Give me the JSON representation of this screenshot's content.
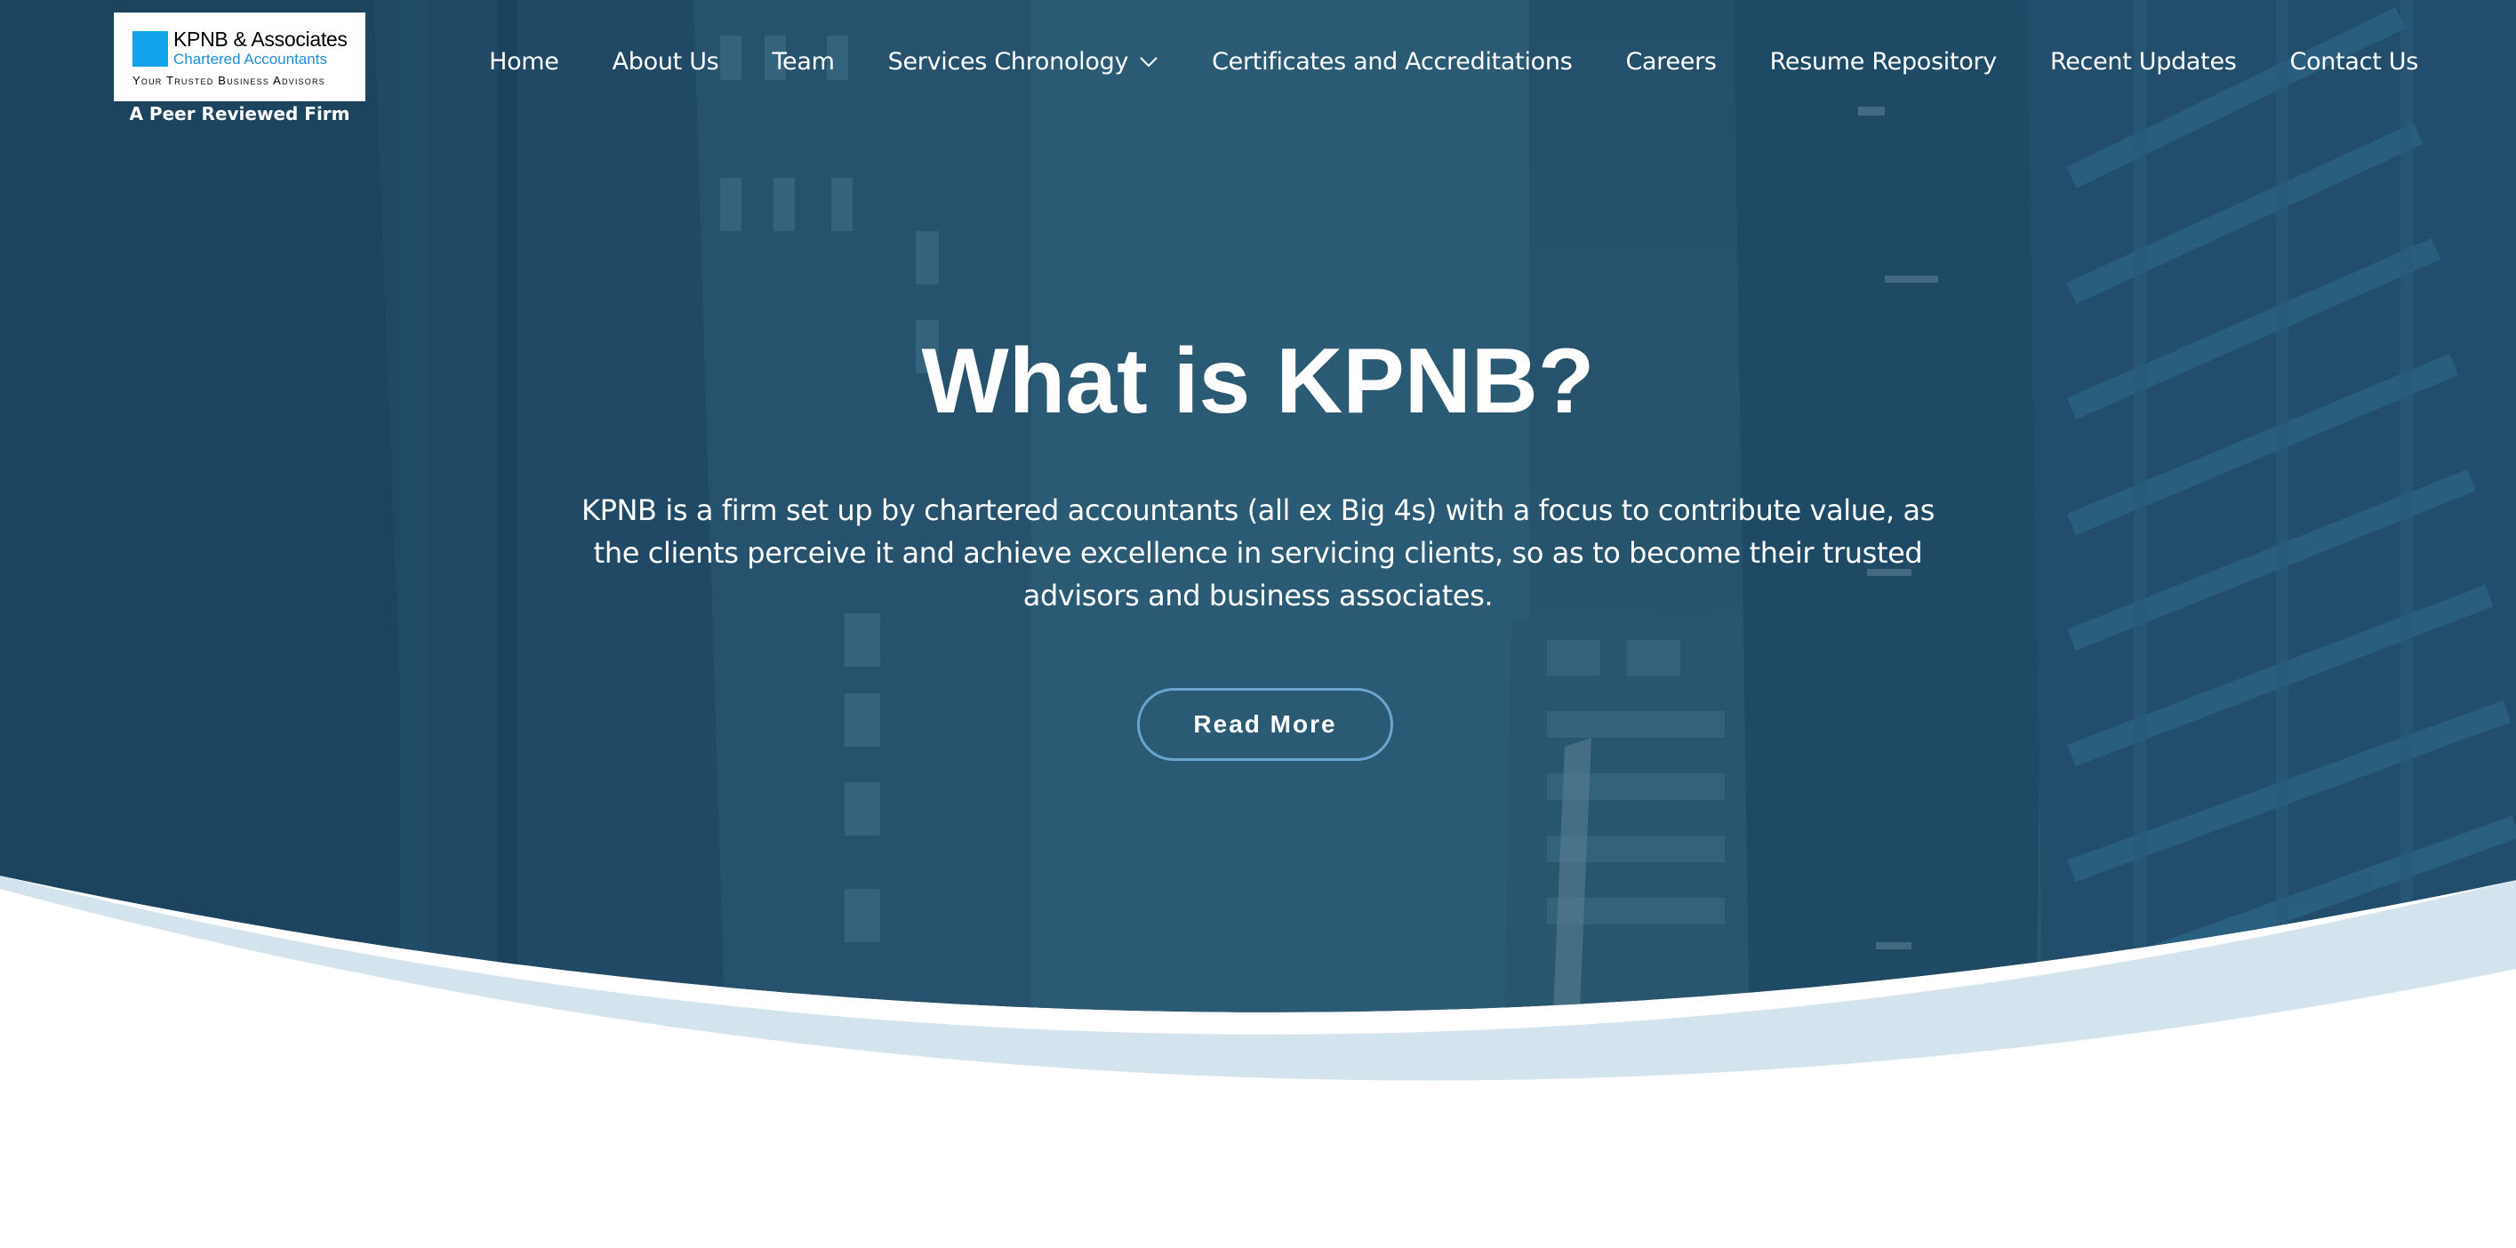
{
  "brand": {
    "name": "KPNB & Associates",
    "subtitle": "Chartered Accountants",
    "tagline": "Your Trusted Business Advisors",
    "peer_note": "A Peer Reviewed Firm"
  },
  "nav": {
    "items": [
      {
        "label": "Home"
      },
      {
        "label": "About Us"
      },
      {
        "label": "Team"
      },
      {
        "label": "Services Chronology",
        "has_dropdown": true
      },
      {
        "label": "Certificates and Accreditations"
      },
      {
        "label": "Careers"
      },
      {
        "label": "Resume Repository"
      },
      {
        "label": "Recent Updates"
      },
      {
        "label": "Contact Us"
      }
    ]
  },
  "hero": {
    "title": "What is KPNB?",
    "description": "KPNB is a firm set up by chartered accountants (all ex Big 4s) with a focus to contribute value, as the clients perceive it and achieve excellence in servicing clients, so as to become their trusted advisors and business associates.",
    "cta_label": "Read More"
  },
  "colors": {
    "hero_overlay": "#1f4a66",
    "wave_light": "#d3e4ee",
    "logo_blue": "#12a4ea",
    "button_border": "#6aa6cf"
  }
}
